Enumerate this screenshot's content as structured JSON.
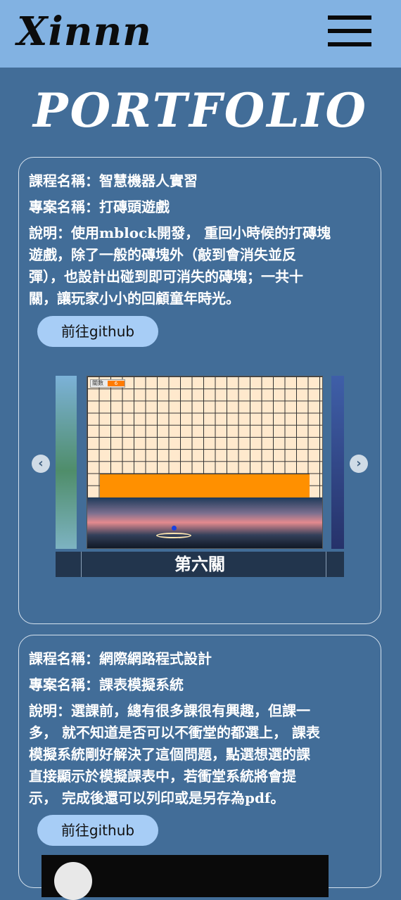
{
  "header": {
    "logo": "Xinnn",
    "menu_icon": "hamburger-menu-icon"
  },
  "page_title": "PORTFOLIO",
  "projects": [
    {
      "course": "課程名稱：智慧機器人實習",
      "project": "專案名稱：打磚頭遊戲",
      "desc_lines": [
        "說明：使用mblock開發， 重回小時候的打磚塊",
        "遊戲，除了一般的磚塊外（敲到會消失並反",
        "彈），也設計出碰到即可消失的磚塊；一共十",
        "關，讓玩家小小的回顧童年時光。"
      ],
      "button": "前往github",
      "carousel": {
        "caption": "第六關",
        "hud_label": "關數",
        "hud_value": "6",
        "prev_icon": "chevron-left-icon",
        "next_icon": "chevron-right-icon"
      }
    },
    {
      "course": "課程名稱：網際網路程式設計",
      "project": "專案名稱：課表模擬系統",
      "desc_lines": [
        "說明：選課前，總有很多課很有興趣，但課一",
        "多， 就不知道是否可以不衝堂的都選上， 課表",
        "模擬系統剛好解決了這個問題，點選想選的課",
        "直接顯示於模擬課表中，若衝堂系統將會提",
        "示， 完成後還可以列印或是另存為pdf。"
      ],
      "button": "前往github"
    }
  ]
}
